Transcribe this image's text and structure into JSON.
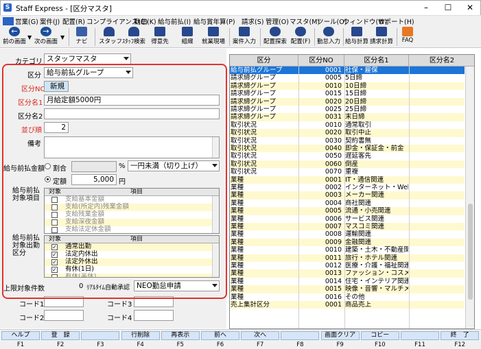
{
  "window": {
    "title": "Staff Express - [区分マスタ]",
    "icon": "app-icon"
  },
  "menu": [
    "営業(G)",
    "案件(J)",
    "配置(R)",
    "コンプライアンス(C)",
    "勤怠(K)",
    "給与前払(I)",
    "給与賞年算(P)",
    "請求(S)",
    "管理(O)",
    "マスタ(M)",
    "ツール(O)",
    "ウィンドウ(W)",
    "サポート(H)"
  ],
  "toolbar": [
    {
      "label": "前の画面",
      "icon": "back-arrow-icon"
    },
    {
      "label": "次の画面",
      "icon": "forward-arrow-icon"
    },
    {
      "label": "ナビ",
      "icon": "navi-icon"
    },
    {
      "label": "スタッフ",
      "icon": "staff-icon"
    },
    {
      "label": "ｽﾀｯﾌ検索",
      "icon": "staff-search-icon"
    },
    {
      "label": "得意先",
      "icon": "client-icon"
    },
    {
      "label": "組織",
      "icon": "organization-icon"
    },
    {
      "label": "就業現場",
      "icon": "workplace-icon"
    },
    {
      "label": "案件入力",
      "icon": "job-entry-icon"
    },
    {
      "label": "配置探索",
      "icon": "placement-search-icon"
    },
    {
      "label": "配置(F)",
      "icon": "placement-icon"
    },
    {
      "label": "勤怠入力",
      "icon": "attendance-icon"
    },
    {
      "label": "給与計算",
      "icon": "payroll-icon"
    },
    {
      "label": "請求計算",
      "icon": "billing-icon"
    },
    {
      "label": "FAQ",
      "icon": "faq-icon"
    }
  ],
  "form": {
    "category_label": "カテゴリ",
    "category_value": "スタッフマスタ",
    "kubun_label": "区分",
    "kubun_value": "給与前払グループ",
    "kubun_no_label": "区分NO",
    "kubun_no_value": "新規",
    "name1_label": "区分名1",
    "name1_value": "月給定額5000円",
    "name2_label": "区分名2",
    "name2_value": "",
    "order_label": "並び順",
    "order_value": "2",
    "note_label": "備考",
    "note_value": "",
    "adv_label": "給与前払金額",
    "ratio_label": "割合",
    "ratio_value": "",
    "percent": "%",
    "rounding_value": "一円未満（切り上げ）",
    "fixed_label": "定額",
    "fixed_value": "5,000",
    "yen": "円",
    "target_items_label": "給与前払\n対象項目",
    "target_attend_label": "給与前払\n対象出勤\n区分",
    "col_target": "対象",
    "col_item": "項目",
    "items": [
      {
        "checked": false,
        "label": "支給基本金額",
        "y": false
      },
      {
        "checked": false,
        "label": "支給(所定内)残業金額",
        "y": true
      },
      {
        "checked": false,
        "label": "支給残業金額",
        "y": false
      },
      {
        "checked": false,
        "label": "支給深夜金額",
        "y": true
      },
      {
        "checked": false,
        "label": "支給法定休金額",
        "y": false
      }
    ],
    "attend": [
      {
        "checked": true,
        "label": "通常出勤",
        "y": true
      },
      {
        "checked": true,
        "label": "法定内休出",
        "y": false
      },
      {
        "checked": true,
        "label": "法定外休出",
        "y": true
      },
      {
        "checked": true,
        "label": "有休(1日)",
        "y": false
      },
      {
        "checked": false,
        "label": "有休(半休)",
        "y": true
      }
    ],
    "limit_label": "上限対象件数",
    "limit_value": "0",
    "auto_label": "ﾘｱﾙﾀｲﾑ自動承認",
    "auto_value": "NEO勤怠申請",
    "code1_label": "コード1",
    "code2_label": "コード2",
    "code3_label": "コード3",
    "code4_label": "コード4"
  },
  "grid": {
    "headers": [
      "区分",
      "区分NO",
      "区分名1",
      "区分名2"
    ],
    "rows": [
      [
        "給与前払グループ",
        "0001",
        "社保・雇保",
        ""
      ],
      [
        "請求締グループ",
        "0005",
        "5日締",
        ""
      ],
      [
        "請求締グループ",
        "0010",
        "10日締",
        ""
      ],
      [
        "請求締グループ",
        "0015",
        "15日締",
        ""
      ],
      [
        "請求締グループ",
        "0020",
        "20日締",
        ""
      ],
      [
        "請求締グループ",
        "0025",
        "25日締",
        ""
      ],
      [
        "請求締グループ",
        "0031",
        "末日締",
        ""
      ],
      [
        "取引状況",
        "0010",
        "通常取引",
        ""
      ],
      [
        "取引状況",
        "0020",
        "取引中止",
        ""
      ],
      [
        "取引状況",
        "0030",
        "契約書無",
        ""
      ],
      [
        "取引状況",
        "0040",
        "即金・保証金・前金",
        ""
      ],
      [
        "取引状況",
        "0050",
        "遅延客先",
        ""
      ],
      [
        "取引状況",
        "0060",
        "倒産",
        ""
      ],
      [
        "取引状況",
        "0070",
        "重複",
        ""
      ],
      [
        "業種",
        "0001",
        "IT・通信関連",
        ""
      ],
      [
        "業種",
        "0002",
        "インターネット・Web!",
        ""
      ],
      [
        "業種",
        "0003",
        "メーカー関連",
        ""
      ],
      [
        "業種",
        "0004",
        "商社関連",
        ""
      ],
      [
        "業種",
        "0005",
        "流通・小売関連",
        ""
      ],
      [
        "業種",
        "0006",
        "サービス関連",
        ""
      ],
      [
        "業種",
        "0007",
        "マスコミ関連",
        ""
      ],
      [
        "業種",
        "0008",
        "運輸関連",
        ""
      ],
      [
        "業種",
        "0009",
        "金融関連",
        ""
      ],
      [
        "業種",
        "0010",
        "建築・土木・不動産関",
        ""
      ],
      [
        "業種",
        "0011",
        "旅行・ホテル関連",
        ""
      ],
      [
        "業種",
        "0012",
        "医療・介護・福祉関連",
        ""
      ],
      [
        "業種",
        "0013",
        "ファッション・コスメ",
        ""
      ],
      [
        "業種",
        "0014",
        "住宅・インテリア関連",
        ""
      ],
      [
        "業種",
        "0015",
        "映像・音響・マルチメ",
        ""
      ],
      [
        "業種",
        "0016",
        "その他",
        ""
      ],
      [
        "売上集計区分",
        "0001",
        "商品売上",
        ""
      ]
    ]
  },
  "fkeys": [
    {
      "label": "ヘルプ",
      "key": "F1"
    },
    {
      "label": "登　録",
      "key": "F2"
    },
    {
      "label": "",
      "key": "F3"
    },
    {
      "label": "行削除",
      "key": "F4"
    },
    {
      "label": "再表示",
      "key": "F5"
    },
    {
      "label": "前へ",
      "key": "F6"
    },
    {
      "label": "次へ",
      "key": "F7"
    },
    {
      "label": "",
      "key": "F8"
    },
    {
      "label": "画面クリア",
      "key": "F9"
    },
    {
      "label": "コピー",
      "key": "F10"
    },
    {
      "label": "",
      "key": "F11"
    },
    {
      "label": "終　了",
      "key": "F12"
    }
  ],
  "colors": {
    "highlight_box": "#e0332d",
    "selected_row": "#1c75d8",
    "alt_row": "#fff9cf",
    "fkey": "#d7e6f6"
  }
}
